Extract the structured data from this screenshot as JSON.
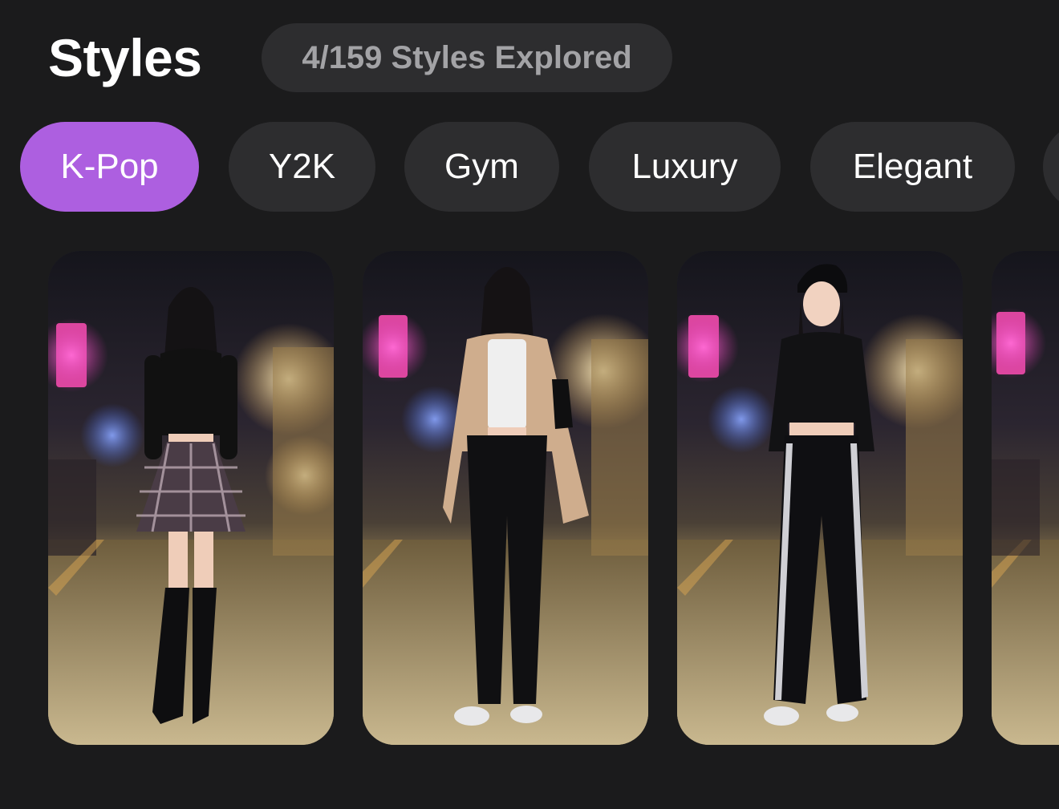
{
  "header": {
    "title": "Styles",
    "explored_badge": "4/159 Styles Explored"
  },
  "categories": [
    {
      "label": "K-Pop",
      "active": true
    },
    {
      "label": "Y2K",
      "active": false
    },
    {
      "label": "Gym",
      "active": false
    },
    {
      "label": "Luxury",
      "active": false
    },
    {
      "label": "Elegant",
      "active": false
    }
  ],
  "colors": {
    "background": "#1b1b1c",
    "chip": "#2d2d2f",
    "chip_active": "#ad5fe0",
    "badge_text": "#a3a3a6",
    "text": "#ffffff"
  },
  "cards": [
    {
      "image": "photo of a woman in black crop top, plaid mini skirt and knee-high boots on a neon-lit street at night"
    },
    {
      "image": "photo of a woman in beige blazer, white top and black wide-leg trousers on a neon-lit street at night"
    },
    {
      "image": "photo of a woman in black beanie, black crop hoodie and track pants with white stripes on a neon-lit street at night"
    },
    {
      "image": "partially visible photo of a neon-lit street at night"
    }
  ]
}
